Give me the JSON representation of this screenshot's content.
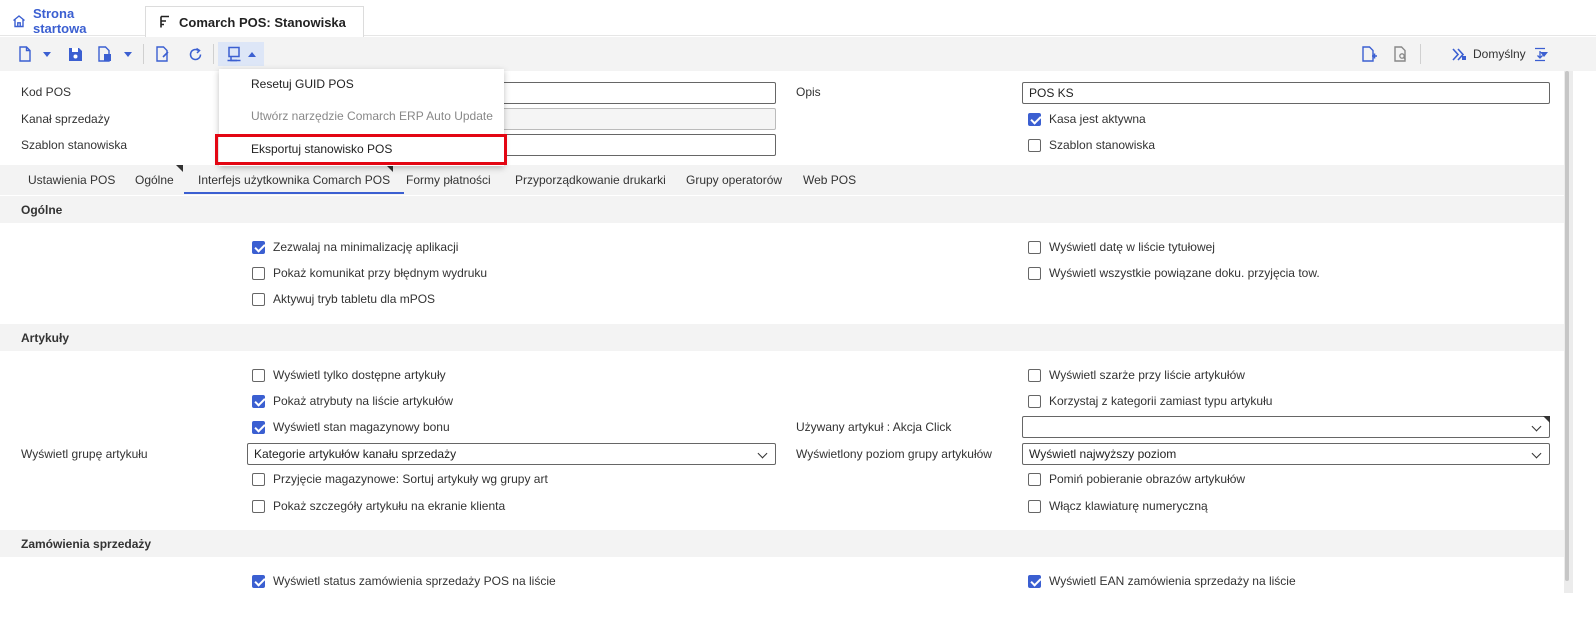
{
  "tabs": [
    {
      "label": "Strona startowa",
      "icon": "home-icon"
    },
    {
      "label": "Comarch POS: Stanowiska",
      "icon": "document-tree-icon"
    }
  ],
  "toolbar": {
    "profile_label": "Domyślny"
  },
  "dropdown_menu": {
    "items": [
      {
        "label": "Resetuj GUID POS",
        "enabled": true
      },
      {
        "label": "Utwórz narzędzie Comarch ERP Auto Update",
        "enabled": false
      },
      {
        "label": "Eksportuj stanowisko POS",
        "enabled": true,
        "highlighted": true
      }
    ]
  },
  "header": {
    "kod_pos_label": "Kod POS",
    "kanal_label": "Kanał sprzedaży",
    "szablon_label": "Szablon stanowiska",
    "opis_label": "Opis",
    "opis_value": "POS KS",
    "kasa_aktywna_label": "Kasa jest aktywna",
    "kasa_aktywna_checked": true,
    "szablon_cb_label": "Szablon stanowiska",
    "szablon_cb_checked": false
  },
  "form_tabs": [
    {
      "label": "Ustawienia POS",
      "active": false
    },
    {
      "label": "Ogólne",
      "active": false
    },
    {
      "label": "Interfejs użytkownika Comarch POS",
      "active": true
    },
    {
      "label": "Formy płatności",
      "active": false
    },
    {
      "label": "Przyporządkowanie drukarki",
      "active": false
    },
    {
      "label": "Grupy operatorów",
      "active": false
    },
    {
      "label": "Web POS",
      "active": false
    }
  ],
  "sections": {
    "ogolne": {
      "title": "Ogólne",
      "left": [
        {
          "label": "Zezwalaj na minimalizację aplikacji",
          "checked": true
        },
        {
          "label": "Pokaż komunikat przy błędnym wydruku",
          "checked": false
        },
        {
          "label": "Aktywuj tryb tabletu dla mPOS",
          "checked": false
        }
      ],
      "right": [
        {
          "label": "Wyświetl datę w liście tytułowej",
          "checked": false
        },
        {
          "label": "Wyświetl wszystkie powiązane doku. przyjęcia tow.",
          "checked": false
        }
      ]
    },
    "artykuly": {
      "title": "Artykuły",
      "left": [
        {
          "label": "Wyświetl tylko dostępne artykuły",
          "checked": false
        },
        {
          "label": "Pokaż atrybuty na liście artykułów",
          "checked": true
        },
        {
          "label": "Wyświetl stan magazynowy bonu",
          "checked": true
        },
        {
          "label": "Przyjęcie magazynowe: Sortuj artykuły wg grupy art",
          "checked": false
        },
        {
          "label": "Pokaż szczegóły artykułu na ekranie klienta",
          "checked": false
        }
      ],
      "right": [
        {
          "label": "Wyświetl szarże przy liście artykułów",
          "checked": false
        },
        {
          "label": "Korzystaj z kategorii zamiast typu artykułu",
          "checked": false
        },
        {
          "label": "Pomiń pobieranie obrazów artykułów",
          "checked": false
        },
        {
          "label": "Włącz klawiaturę numeryczną",
          "checked": false
        }
      ],
      "grupa_label": "Wyświetl grupę artykułu",
      "grupa_value": "Kategorie artykułów kanału sprzedaży",
      "uzywany_label": "Używany artykuł : Akcja Click",
      "uzywany_value": "",
      "poziom_label": "Wyświetlony poziom grupy artykułów",
      "poziom_value": "Wyświetl najwyższy poziom"
    },
    "zamowienia": {
      "title": "Zamówienia sprzedaży",
      "left": [
        {
          "label": "Wyświetl status zamówienia sprzedaży POS na liście",
          "checked": true
        }
      ],
      "right": [
        {
          "label": "Wyświetl EAN zamówienia sprzedaży na liście",
          "checked": true
        }
      ]
    }
  },
  "colors": {
    "accent": "#3b5fd1",
    "highlight": "#e30613",
    "section_bg": "#f3f3f3"
  }
}
